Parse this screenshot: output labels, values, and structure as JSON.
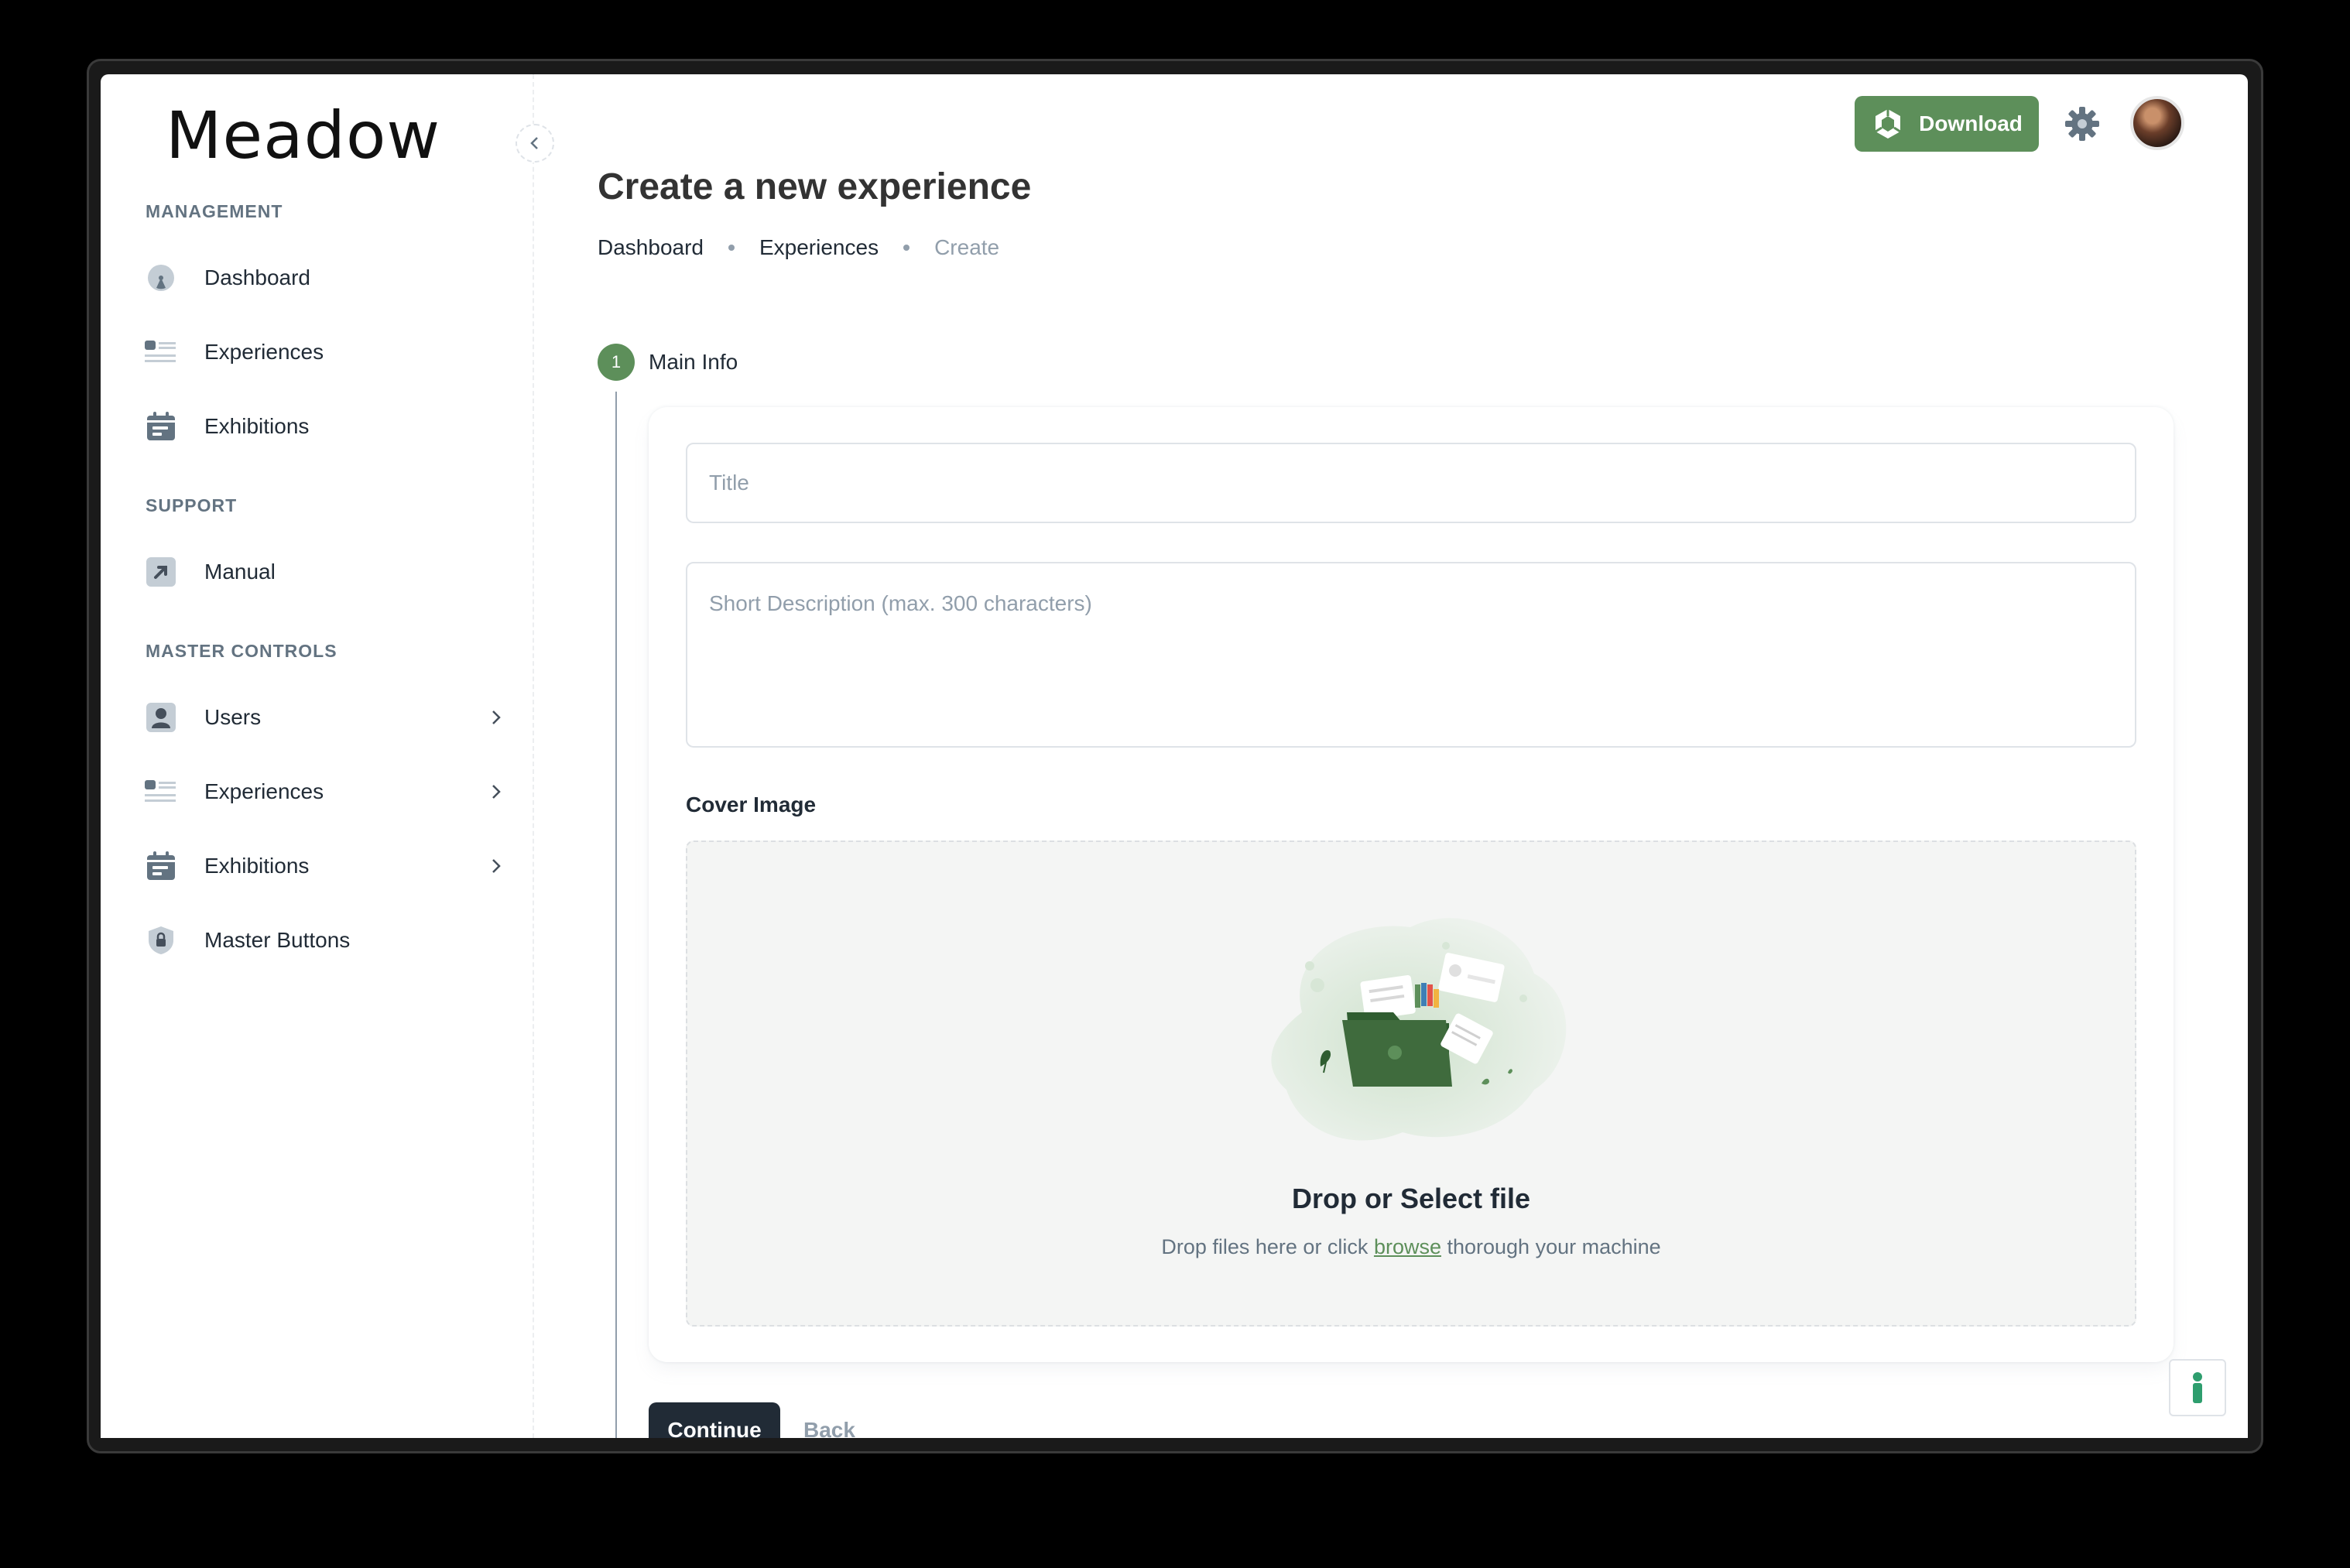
{
  "app": {
    "name": "Meadow"
  },
  "sidebar": {
    "sections": [
      {
        "title": "MANAGEMENT",
        "items": [
          {
            "label": "Dashboard",
            "icon": "dashboard-icon"
          },
          {
            "label": "Experiences",
            "icon": "list-icon"
          },
          {
            "label": "Exhibitions",
            "icon": "calendar-icon"
          }
        ]
      },
      {
        "title": "SUPPORT",
        "items": [
          {
            "label": "Manual",
            "icon": "external-link-icon"
          }
        ]
      },
      {
        "title": "MASTER CONTROLS",
        "items": [
          {
            "label": "Users",
            "icon": "user-icon",
            "expandable": true
          },
          {
            "label": "Experiences",
            "icon": "list-icon",
            "expandable": true
          },
          {
            "label": "Exhibitions",
            "icon": "calendar-icon",
            "expandable": true
          },
          {
            "label": "Master Buttons",
            "icon": "lock-icon"
          }
        ]
      }
    ]
  },
  "header": {
    "download_label": "Download"
  },
  "page": {
    "title": "Create a new experience",
    "breadcrumb": [
      "Dashboard",
      "Experiences",
      "Create"
    ]
  },
  "step": {
    "number": "1",
    "label": "Main Info"
  },
  "form": {
    "title_placeholder": "Title",
    "title_value": "",
    "description_placeholder": "Short Description (max. 300 characters)",
    "description_value": "",
    "cover_label": "Cover Image",
    "drop_title": "Drop or Select file",
    "drop_sub_before": "Drop files here or click ",
    "drop_sub_link": "browse",
    "drop_sub_after": " thorough your machine"
  },
  "actions": {
    "continue_label": "Continue",
    "back_label": "Back"
  },
  "colors": {
    "accent": "#5d8f5a",
    "dark": "#212b36",
    "muted": "#919eab"
  }
}
